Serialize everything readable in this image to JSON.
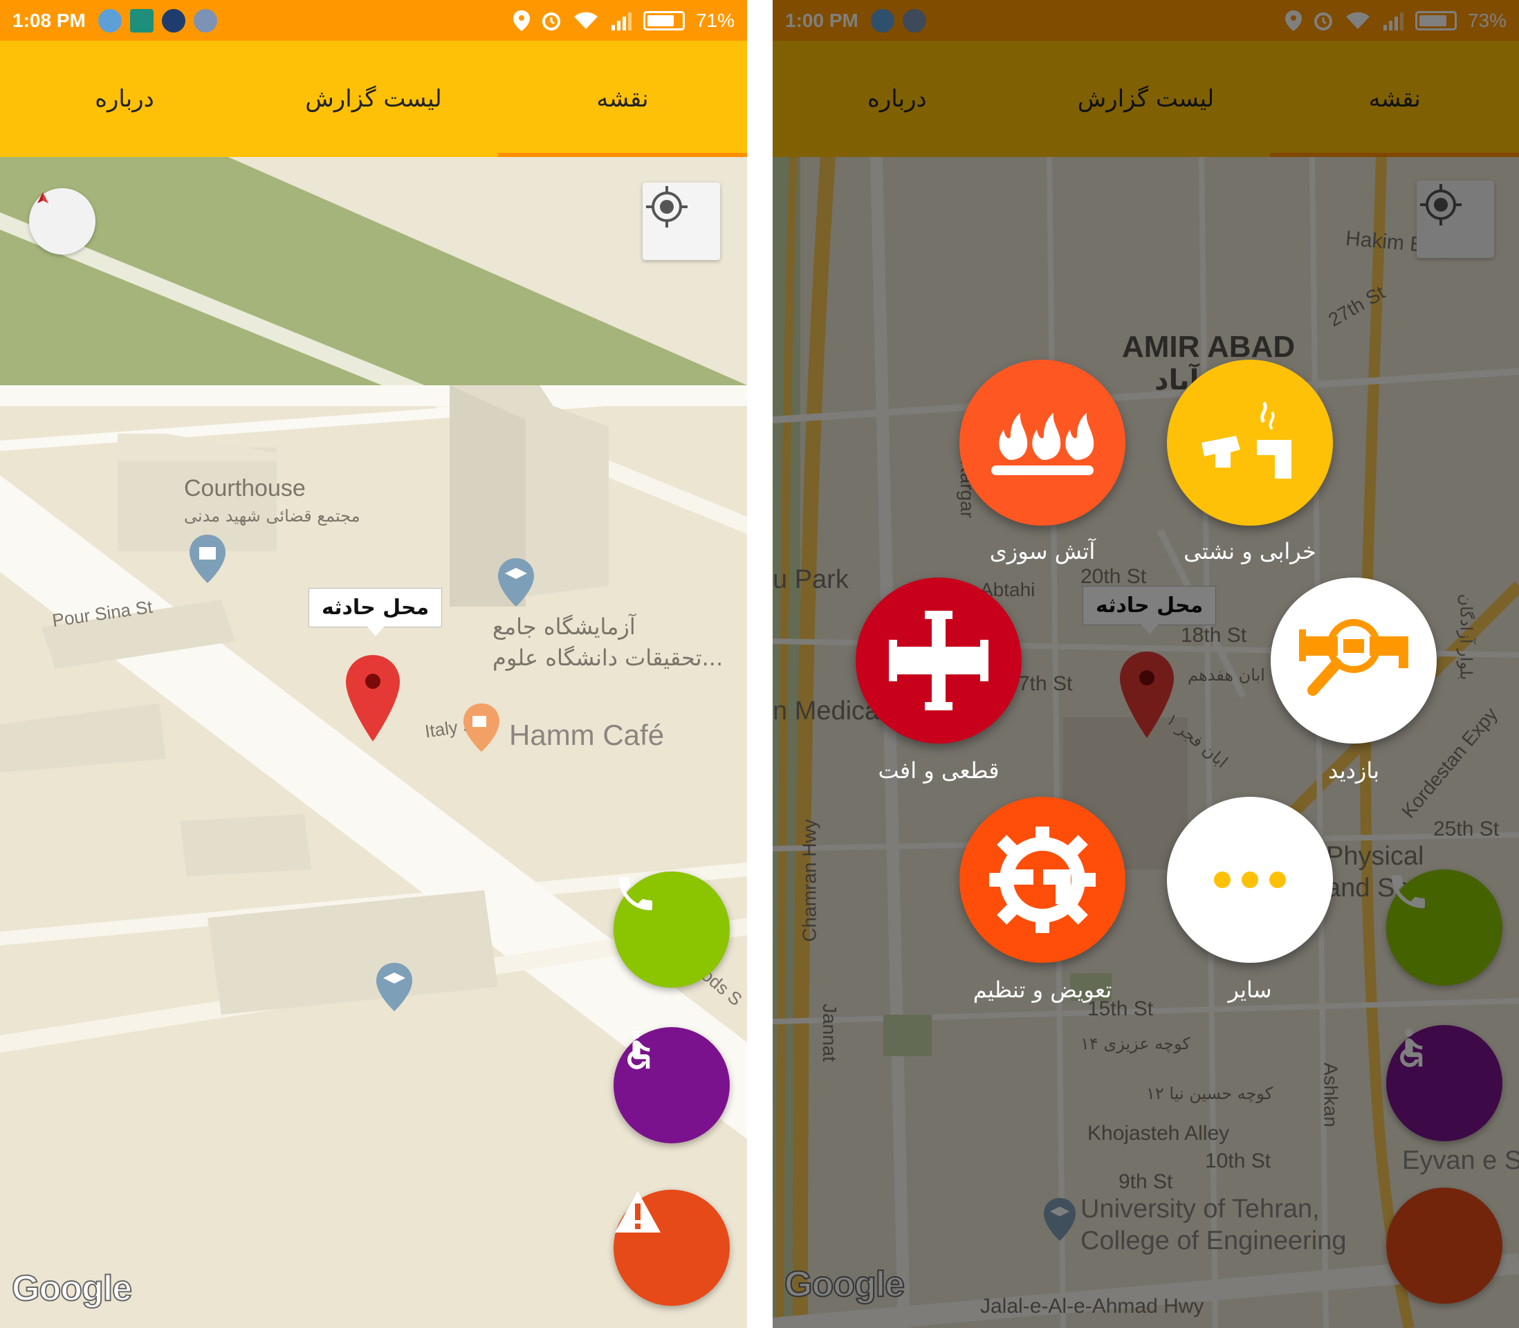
{
  "left": {
    "status": {
      "time": "1:08 PM",
      "battery": "71%",
      "battery_level": 0.71
    },
    "tabs": [
      "نقشه",
      "لیست گزارش",
      "درباره"
    ],
    "active_tab": 0,
    "map_labels": {
      "courthouse_en": "Courthouse",
      "courthouse_fa": "مجتمع قضائی شهید مدنی",
      "pour_sina": "Pour Sina St",
      "lab_line1": "آزمایشگاه جامع",
      "lab_line2": "تحقیقات دانشگاه علوم...",
      "italy": "Italy St",
      "hamm": "Hamm Café",
      "woods": "ods S"
    },
    "callout": "محل حادثه",
    "google": "Google",
    "colors": {
      "statusbar": "#ff9800",
      "appbar": "#ffc107",
      "call": "#8bc400",
      "wheelchair": "#7b128d",
      "alert": "#e64a19"
    }
  },
  "right": {
    "status": {
      "time": "1:00 PM",
      "battery": "73%",
      "battery_level": 0.73
    },
    "tabs": [
      "نقشه",
      "لیست گزارش",
      "درباره"
    ],
    "active_tab": 0,
    "map_labels": {
      "hakim": "Hakim Expy",
      "st27": "27th St",
      "amir_abad": "AMIR ABAD",
      "amir_fa": "آباد",
      "kargar": "N Kargar",
      "park": "u Park",
      "abtahi": "Abtahi",
      "st20": "20th St",
      "st18": "18th St",
      "st17": "7th St",
      "medica": "n Medica",
      "hafdahom": "ابان هفدهم",
      "fajr": "ابان فجر ۱",
      "chamran": "Chamran Hwy",
      "st25": "25th St",
      "kordestan": "Kordestan Expy",
      "physical": "Physical",
      "and_sp": "and Sp",
      "azadegan": "بلوار آزادگان",
      "jannat": "Jannat",
      "st15": "15th St",
      "azizi": "کوچه عزیزی ۱۴",
      "hosein": "کوچه حسین نیا ۱۲",
      "ashkan": "Ashkan",
      "khojasteh": "Khojasteh Alley",
      "st10": "10th St",
      "st9": "9th St",
      "univ1": "University of Tehran,",
      "univ2": "College of Engineering",
      "eyvan": "Eyvan e Sh",
      "jalal": "Jalal-e-Al-e-Ahmad Hwy"
    },
    "callout": "محل حادثه",
    "google": "Google",
    "menu": [
      {
        "label": "آتش سوزی",
        "icon": "fire-icon",
        "color": "#ff5722"
      },
      {
        "label": "خرابی و نشتی",
        "icon": "broken-pipe-icon",
        "color": "#ffc107"
      },
      {
        "label": "قطعی و افت",
        "icon": "pipe-cross-icon",
        "color": "#c8001b"
      },
      {
        "label": "بازدید",
        "icon": "pipe-inspect-icon",
        "color": "#ffffff"
      },
      {
        "label": "تعویض و تنظیم",
        "icon": "gear-pipe-icon",
        "color": "#ff4e0a"
      },
      {
        "label": "سایر",
        "icon": "more-icon",
        "color": "#ffffff"
      }
    ]
  }
}
